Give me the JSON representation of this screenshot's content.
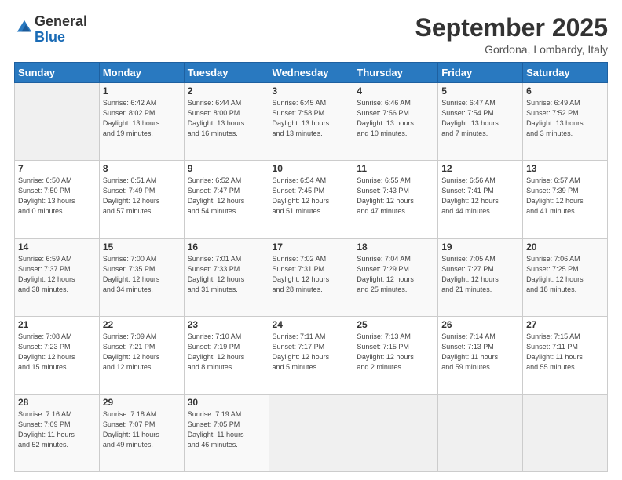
{
  "logo": {
    "general": "General",
    "blue": "Blue"
  },
  "header": {
    "title": "September 2025",
    "location": "Gordona, Lombardy, Italy"
  },
  "weekdays": [
    "Sunday",
    "Monday",
    "Tuesday",
    "Wednesday",
    "Thursday",
    "Friday",
    "Saturday"
  ],
  "weeks": [
    [
      {
        "day": "",
        "info": ""
      },
      {
        "day": "1",
        "info": "Sunrise: 6:42 AM\nSunset: 8:02 PM\nDaylight: 13 hours\nand 19 minutes."
      },
      {
        "day": "2",
        "info": "Sunrise: 6:44 AM\nSunset: 8:00 PM\nDaylight: 13 hours\nand 16 minutes."
      },
      {
        "day": "3",
        "info": "Sunrise: 6:45 AM\nSunset: 7:58 PM\nDaylight: 13 hours\nand 13 minutes."
      },
      {
        "day": "4",
        "info": "Sunrise: 6:46 AM\nSunset: 7:56 PM\nDaylight: 13 hours\nand 10 minutes."
      },
      {
        "day": "5",
        "info": "Sunrise: 6:47 AM\nSunset: 7:54 PM\nDaylight: 13 hours\nand 7 minutes."
      },
      {
        "day": "6",
        "info": "Sunrise: 6:49 AM\nSunset: 7:52 PM\nDaylight: 13 hours\nand 3 minutes."
      }
    ],
    [
      {
        "day": "7",
        "info": "Sunrise: 6:50 AM\nSunset: 7:50 PM\nDaylight: 13 hours\nand 0 minutes."
      },
      {
        "day": "8",
        "info": "Sunrise: 6:51 AM\nSunset: 7:49 PM\nDaylight: 12 hours\nand 57 minutes."
      },
      {
        "day": "9",
        "info": "Sunrise: 6:52 AM\nSunset: 7:47 PM\nDaylight: 12 hours\nand 54 minutes."
      },
      {
        "day": "10",
        "info": "Sunrise: 6:54 AM\nSunset: 7:45 PM\nDaylight: 12 hours\nand 51 minutes."
      },
      {
        "day": "11",
        "info": "Sunrise: 6:55 AM\nSunset: 7:43 PM\nDaylight: 12 hours\nand 47 minutes."
      },
      {
        "day": "12",
        "info": "Sunrise: 6:56 AM\nSunset: 7:41 PM\nDaylight: 12 hours\nand 44 minutes."
      },
      {
        "day": "13",
        "info": "Sunrise: 6:57 AM\nSunset: 7:39 PM\nDaylight: 12 hours\nand 41 minutes."
      }
    ],
    [
      {
        "day": "14",
        "info": "Sunrise: 6:59 AM\nSunset: 7:37 PM\nDaylight: 12 hours\nand 38 minutes."
      },
      {
        "day": "15",
        "info": "Sunrise: 7:00 AM\nSunset: 7:35 PM\nDaylight: 12 hours\nand 34 minutes."
      },
      {
        "day": "16",
        "info": "Sunrise: 7:01 AM\nSunset: 7:33 PM\nDaylight: 12 hours\nand 31 minutes."
      },
      {
        "day": "17",
        "info": "Sunrise: 7:02 AM\nSunset: 7:31 PM\nDaylight: 12 hours\nand 28 minutes."
      },
      {
        "day": "18",
        "info": "Sunrise: 7:04 AM\nSunset: 7:29 PM\nDaylight: 12 hours\nand 25 minutes."
      },
      {
        "day": "19",
        "info": "Sunrise: 7:05 AM\nSunset: 7:27 PM\nDaylight: 12 hours\nand 21 minutes."
      },
      {
        "day": "20",
        "info": "Sunrise: 7:06 AM\nSunset: 7:25 PM\nDaylight: 12 hours\nand 18 minutes."
      }
    ],
    [
      {
        "day": "21",
        "info": "Sunrise: 7:08 AM\nSunset: 7:23 PM\nDaylight: 12 hours\nand 15 minutes."
      },
      {
        "day": "22",
        "info": "Sunrise: 7:09 AM\nSunset: 7:21 PM\nDaylight: 12 hours\nand 12 minutes."
      },
      {
        "day": "23",
        "info": "Sunrise: 7:10 AM\nSunset: 7:19 PM\nDaylight: 12 hours\nand 8 minutes."
      },
      {
        "day": "24",
        "info": "Sunrise: 7:11 AM\nSunset: 7:17 PM\nDaylight: 12 hours\nand 5 minutes."
      },
      {
        "day": "25",
        "info": "Sunrise: 7:13 AM\nSunset: 7:15 PM\nDaylight: 12 hours\nand 2 minutes."
      },
      {
        "day": "26",
        "info": "Sunrise: 7:14 AM\nSunset: 7:13 PM\nDaylight: 11 hours\nand 59 minutes."
      },
      {
        "day": "27",
        "info": "Sunrise: 7:15 AM\nSunset: 7:11 PM\nDaylight: 11 hours\nand 55 minutes."
      }
    ],
    [
      {
        "day": "28",
        "info": "Sunrise: 7:16 AM\nSunset: 7:09 PM\nDaylight: 11 hours\nand 52 minutes."
      },
      {
        "day": "29",
        "info": "Sunrise: 7:18 AM\nSunset: 7:07 PM\nDaylight: 11 hours\nand 49 minutes."
      },
      {
        "day": "30",
        "info": "Sunrise: 7:19 AM\nSunset: 7:05 PM\nDaylight: 11 hours\nand 46 minutes."
      },
      {
        "day": "",
        "info": ""
      },
      {
        "day": "",
        "info": ""
      },
      {
        "day": "",
        "info": ""
      },
      {
        "day": "",
        "info": ""
      }
    ]
  ]
}
